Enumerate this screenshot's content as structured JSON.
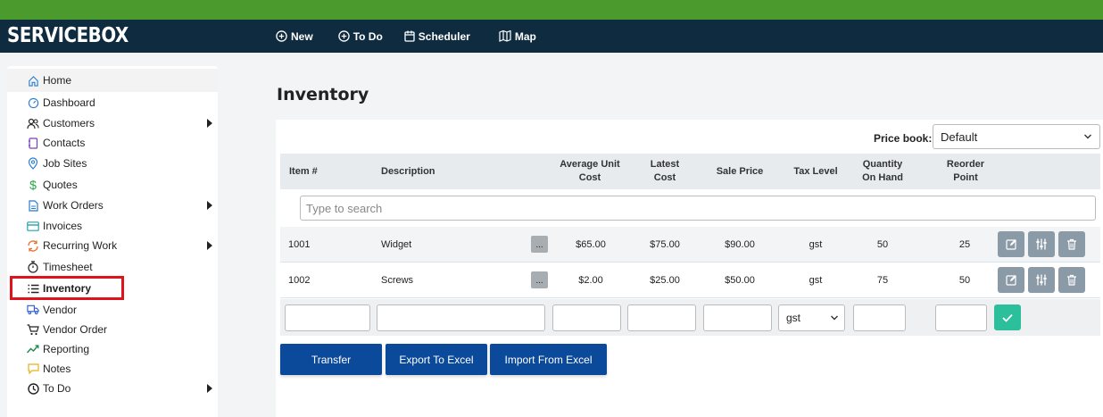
{
  "app": {
    "brand": "SERVICEBOX"
  },
  "topnav": [
    {
      "label": "New",
      "icon": "plus-circle-icon"
    },
    {
      "label": "To Do",
      "icon": "plus-circle-icon"
    },
    {
      "label": "Scheduler",
      "icon": "calendar-icon"
    },
    {
      "label": "Map",
      "icon": "map-icon"
    }
  ],
  "sidebar": {
    "items": [
      {
        "label": "Home",
        "icon": "home-icon"
      },
      {
        "label": "Dashboard",
        "icon": "dashboard-icon"
      },
      {
        "label": "Customers",
        "icon": "users-icon"
      },
      {
        "label": "Contacts",
        "icon": "contact-book-icon"
      },
      {
        "label": "Job Sites",
        "icon": "location-pin-icon"
      },
      {
        "label": "Quotes",
        "icon": "dollar-icon"
      },
      {
        "label": "Work Orders",
        "icon": "document-icon"
      },
      {
        "label": "Invoices",
        "icon": "credit-card-icon"
      },
      {
        "label": "Recurring Work",
        "icon": "refresh-icon"
      },
      {
        "label": "Timesheet",
        "icon": "stopwatch-icon"
      },
      {
        "label": "Inventory",
        "icon": "list-icon"
      },
      {
        "label": "Vendor",
        "icon": "truck-icon"
      },
      {
        "label": "Vendor Order",
        "icon": "cart-icon"
      },
      {
        "label": "Reporting",
        "icon": "trend-icon"
      },
      {
        "label": "Notes",
        "icon": "comment-icon"
      },
      {
        "label": "To Do",
        "icon": "clock-icon"
      }
    ]
  },
  "main": {
    "title": "Inventory",
    "price_book": {
      "label": "Price book:",
      "value": "Default"
    },
    "columns": {
      "item": "Item #",
      "description": "Description",
      "avg_cost": "Average Unit Cost",
      "latest_cost": "Latest Cost",
      "sale_price": "Sale Price",
      "tax_level": "Tax Level",
      "qty": "Quantity On Hand",
      "reorder": "Reorder Point"
    },
    "search": {
      "placeholder": "Type to search"
    },
    "rows": [
      {
        "item": "1001",
        "description": "Widget",
        "more": "...",
        "avg_cost": "$65.00",
        "latest_cost": "$75.00",
        "sale_price": "$90.00",
        "tax_level": "gst",
        "qty": "50",
        "reorder": "25"
      },
      {
        "item": "1002",
        "description": "Screws",
        "more": "...",
        "avg_cost": "$2.00",
        "latest_cost": "$25.00",
        "sale_price": "$50.00",
        "tax_level": "gst",
        "qty": "75",
        "reorder": "50"
      }
    ],
    "add_row": {
      "tax_level": "gst"
    },
    "buttons": {
      "transfer": "Transfer",
      "export": "Export To Excel",
      "import": "Import From Excel"
    }
  },
  "colors": {
    "top_strip": "#4a9a2e",
    "top_bar": "#0f2b40",
    "primary_button": "#0b4a9a",
    "confirm_button": "#2bbf9b",
    "active_highlight": "#e0121c"
  }
}
